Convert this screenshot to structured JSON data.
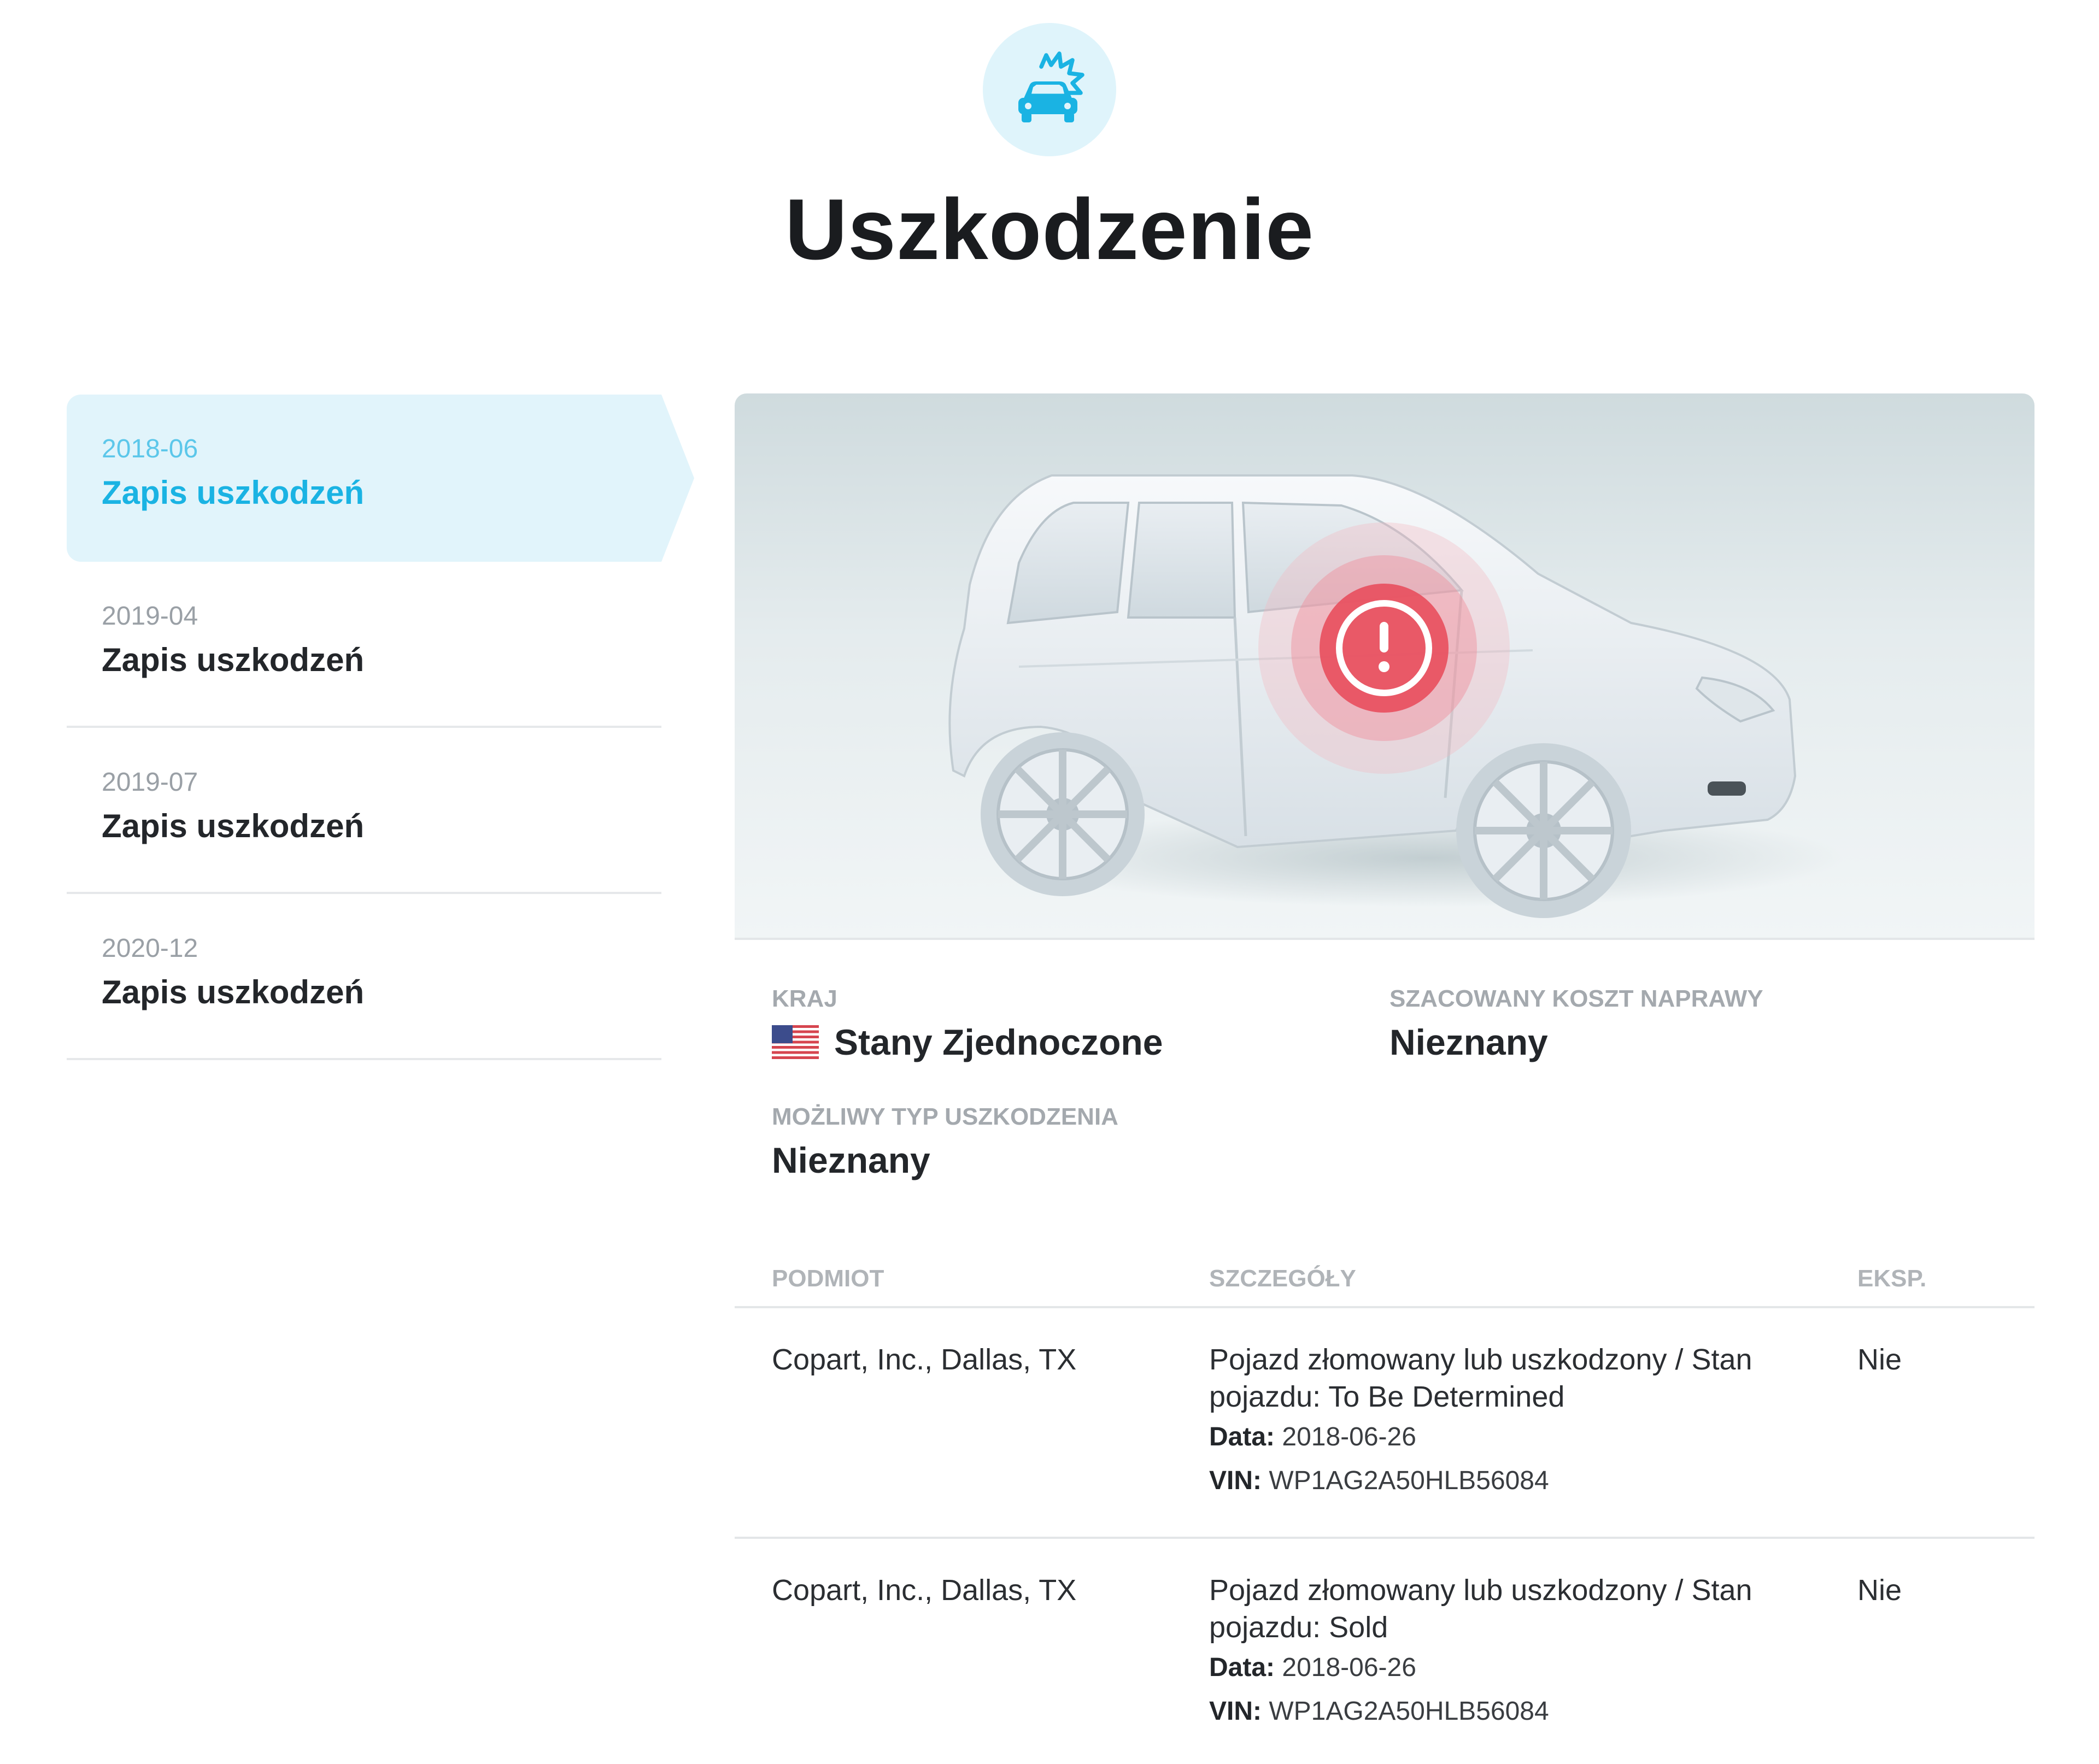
{
  "header": {
    "icon": "car-damage-icon",
    "title": "Uszkodzenie"
  },
  "timeline": [
    {
      "date": "2018-06",
      "label": "Zapis uszkodzeń",
      "active": true
    },
    {
      "date": "2019-04",
      "label": "Zapis uszkodzeń",
      "active": false
    },
    {
      "date": "2019-07",
      "label": "Zapis uszkodzeń",
      "active": false
    },
    {
      "date": "2020-12",
      "label": "Zapis uszkodzeń",
      "active": false
    }
  ],
  "car_panel": {
    "image": "car-illustration",
    "marker_icon": "exclamation-icon"
  },
  "info": {
    "country_label": "KRAJ",
    "country_value": "Stany Zjednoczone",
    "country_flag": "us-flag-icon",
    "repair_cost_label": "SZACOWANY KOSZT NAPRAWY",
    "repair_cost_value": "Nieznany",
    "damage_type_label": "MOŻLIWY TYP USZKODZENIA",
    "damage_type_value": "Nieznany"
  },
  "table": {
    "headers": [
      "PODMIOT",
      "SZCZEGÓŁY",
      "EKSP."
    ],
    "rows": [
      {
        "entity": "Copart, Inc., Dallas, TX",
        "details": "Pojazd złomowany lub uszkodzony / Stan pojazdu: To Be Determined",
        "date_label": "Data:",
        "date_value": "2018-06-26",
        "vin_label": "VIN:",
        "vin_value": "WP1AG2A50HLB56084",
        "export": "Nie"
      },
      {
        "entity": "Copart, Inc., Dallas, TX",
        "details": "Pojazd złomowany lub uszkodzony / Stan pojazdu: Sold",
        "date_label": "Data:",
        "date_value": "2018-06-26",
        "vin_label": "VIN:",
        "vin_value": "WP1AG2A50HLB56084",
        "export": "Nie"
      }
    ]
  },
  "colors": {
    "accent": "#1ab3e3",
    "accent_bg": "#e1f4fb",
    "alert": "#e8505f"
  }
}
